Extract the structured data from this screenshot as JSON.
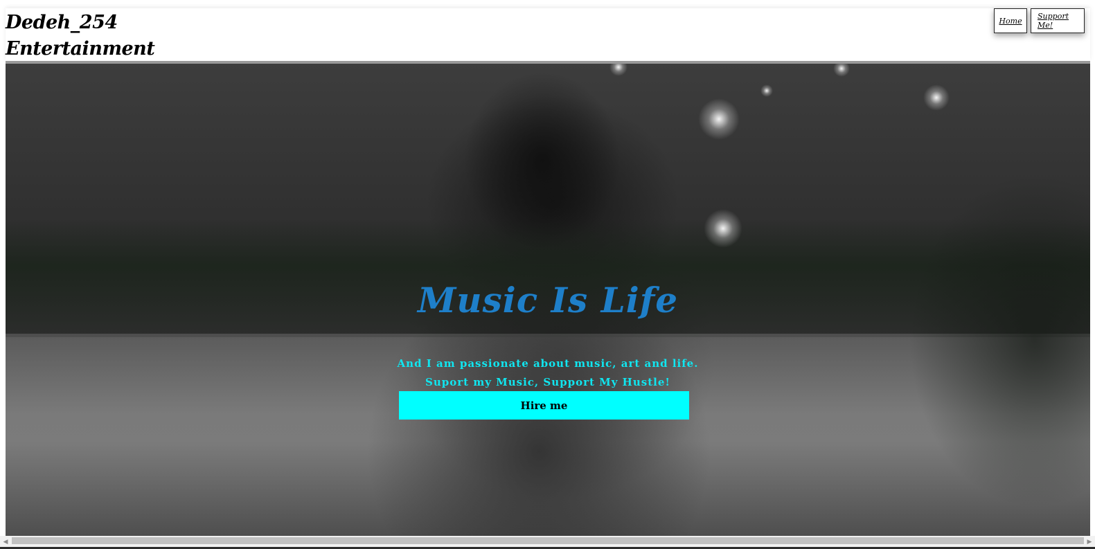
{
  "header": {
    "brand_line1": "Dedeh_254",
    "brand_line2": "Entertainment",
    "nav": [
      {
        "label": "Home"
      },
      {
        "label": "Support Me!"
      }
    ]
  },
  "hero": {
    "title": "Music Is Life",
    "subtitle_line1": "And I am passionate about music, art and life.",
    "subtitle_line2": "Suport my Music, Support My Hustle!",
    "cta_label": "Hire me",
    "colors": {
      "title": "#1e7fc9",
      "subtitle": "#10e6f0",
      "cta_bg": "#00ffff"
    }
  },
  "scrollbar": {
    "left_icon": "arrow-left-icon",
    "right_icon": "arrow-right-icon"
  }
}
